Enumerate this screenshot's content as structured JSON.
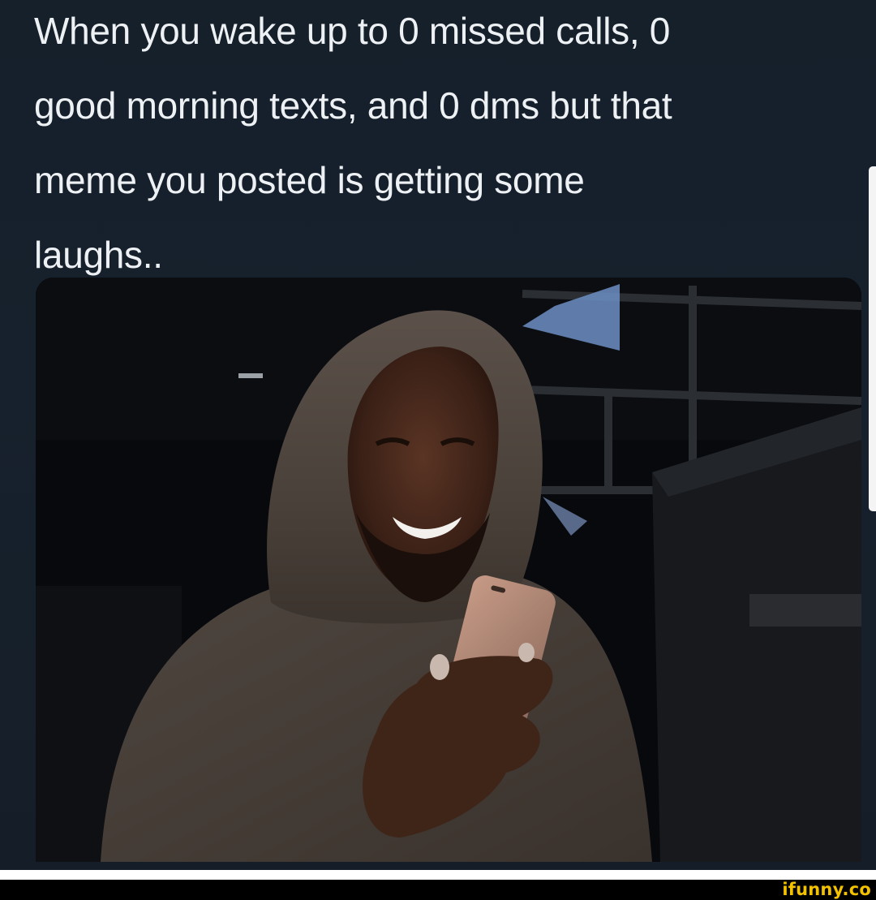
{
  "caption": {
    "line1": "When you wake up to 0 missed calls, 0",
    "line2": "good morning texts, and 0 dms but that",
    "line3": "meme you posted is getting some",
    "line4": "laughs.."
  },
  "watermark": {
    "text": "ifunny.co"
  },
  "colors": {
    "panel_background": "#15202b",
    "caption_text": "#eef1f4",
    "watermark": "#f2c200"
  }
}
